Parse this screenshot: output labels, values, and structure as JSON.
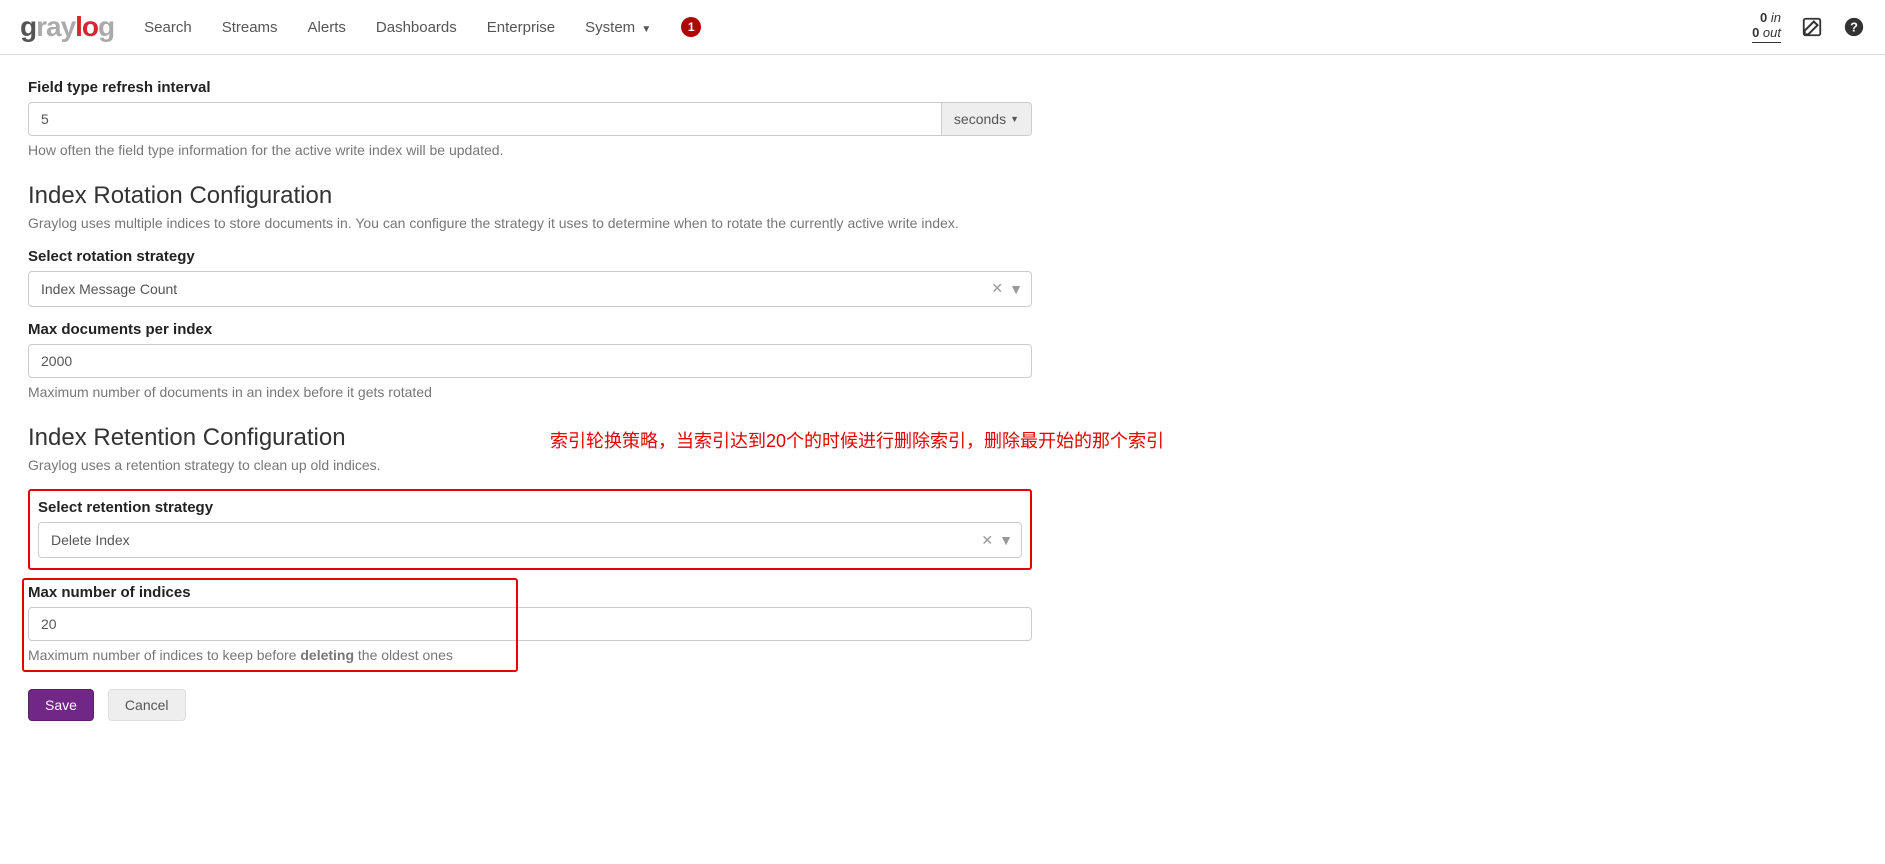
{
  "nav": {
    "links": [
      "Search",
      "Streams",
      "Alerts",
      "Dashboards",
      "Enterprise"
    ],
    "system": "System",
    "badge": "1",
    "throughput_in_num": "0",
    "throughput_in_lbl": "in",
    "throughput_out_num": "0",
    "throughput_out_lbl": "out"
  },
  "field_refresh": {
    "label": "Field type refresh interval",
    "value": "5",
    "unit": "seconds",
    "help": "How often the field type information for the active write index will be updated."
  },
  "rotation": {
    "heading": "Index Rotation Configuration",
    "desc": "Graylog uses multiple indices to store documents in. You can configure the strategy it uses to determine when to rotate the currently active write index.",
    "select_label": "Select rotation strategy",
    "select_value": "Index Message Count",
    "max_docs_label": "Max documents per index",
    "max_docs_value": "2000",
    "max_docs_help": "Maximum number of documents in an index before it gets rotated"
  },
  "retention": {
    "heading": "Index Retention Configuration",
    "desc": "Graylog uses a retention strategy to clean up old indices.",
    "select_label": "Select retention strategy",
    "select_value": "Delete Index",
    "max_label": "Max number of indices",
    "max_value": "20",
    "max_help_pre": "Maximum number of indices to keep before ",
    "max_help_bold": "deleting",
    "max_help_post": " the oldest ones"
  },
  "annotation": "索引轮换策略，当索引达到20个的时候进行删除索引，删除最开始的那个索引",
  "buttons": {
    "save": "Save",
    "cancel": "Cancel"
  }
}
